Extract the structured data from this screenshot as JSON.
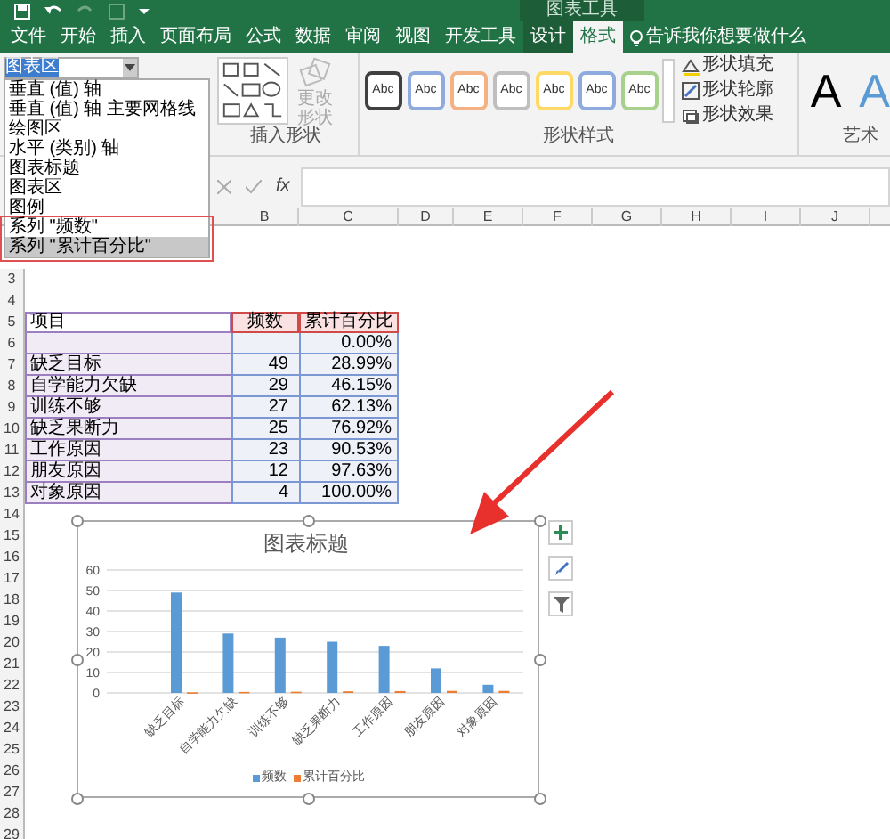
{
  "title_bar": {
    "context_label": "图表工具"
  },
  "ribbon_tabs": [
    {
      "label": "文件",
      "selected": false,
      "kind": "plain"
    },
    {
      "label": "开始",
      "selected": false,
      "kind": "plain"
    },
    {
      "label": "插入",
      "selected": false,
      "kind": "plain"
    },
    {
      "label": "页面布局",
      "selected": false,
      "kind": "plain"
    },
    {
      "label": "公式",
      "selected": false,
      "kind": "plain"
    },
    {
      "label": "数据",
      "selected": false,
      "kind": "plain"
    },
    {
      "label": "审阅",
      "selected": false,
      "kind": "plain"
    },
    {
      "label": "视图",
      "selected": false,
      "kind": "plain"
    },
    {
      "label": "开发工具",
      "selected": false,
      "kind": "plain"
    },
    {
      "label": "设计",
      "selected": false,
      "kind": "context"
    },
    {
      "label": "格式",
      "selected": true,
      "kind": "context"
    }
  ],
  "tell_me": "告诉我你想要做什么",
  "selection_box": {
    "value": "图表区"
  },
  "selection_dropdown": [
    {
      "label": "垂直 (值) 轴",
      "selected": false
    },
    {
      "label": "垂直 (值) 轴 主要网格线",
      "selected": false
    },
    {
      "label": "绘图区",
      "selected": false
    },
    {
      "label": "水平 (类别) 轴",
      "selected": false
    },
    {
      "label": "图表标题",
      "selected": false
    },
    {
      "label": "图表区",
      "selected": false
    },
    {
      "label": "图例",
      "selected": false
    },
    {
      "label": "系列 \"频数\"",
      "selected": false
    },
    {
      "label": "系列 \"累计百分比\"",
      "selected": true
    }
  ],
  "insert_shapes": {
    "change_shape": "更改形状",
    "label": "插入形状"
  },
  "shape_styles": {
    "swatches": [
      {
        "text": "Abc",
        "color": "#404040"
      },
      {
        "text": "Abc",
        "color": "#8faadc"
      },
      {
        "text": "Abc",
        "color": "#f4b183"
      },
      {
        "text": "Abc",
        "color": "#bfbfbf"
      },
      {
        "text": "Abc",
        "color": "#ffd966"
      },
      {
        "text": "Abc",
        "color": "#8faadc"
      },
      {
        "text": "Abc",
        "color": "#a9d18e"
      }
    ],
    "commands": [
      "形状填充",
      "形状轮廓",
      "形状效果"
    ],
    "label": "形状样式"
  },
  "wordart": {
    "samples": [
      {
        "text": "A",
        "color": "#000000"
      },
      {
        "text": "A",
        "color": "#5b9bd5"
      }
    ],
    "label": "艺术"
  },
  "formula_bar": {
    "function_label": "fx"
  },
  "columns": [
    "B",
    "C",
    "D",
    "E",
    "F",
    "G",
    "H",
    "I",
    "J"
  ],
  "row_numbers": [
    "3",
    "4",
    "5",
    "6",
    "7",
    "8",
    "9",
    "10",
    "11",
    "12",
    "13",
    "14",
    "15",
    "16",
    "17",
    "18",
    "19",
    "20",
    "21",
    "22",
    "23",
    "24",
    "25",
    "26",
    "27",
    "28",
    "29"
  ],
  "table": {
    "header": [
      "项目",
      "频数",
      "累计百分比"
    ],
    "rows": [
      {
        "percent": "0.00%"
      },
      {
        "item": "缺乏目标",
        "count": "49",
        "percent": "28.99%"
      },
      {
        "item": "自学能力欠缺",
        "count": "29",
        "percent": "46.15%"
      },
      {
        "item": "训练不够",
        "count": "27",
        "percent": "62.13%"
      },
      {
        "item": "缺乏果断力",
        "count": "25",
        "percent": "76.92%"
      },
      {
        "item": "工作原因",
        "count": "23",
        "percent": "90.53%"
      },
      {
        "item": "朋友原因",
        "count": "12",
        "percent": "97.63%"
      },
      {
        "item": "对象原因",
        "count": "4",
        "percent": "100.00%"
      }
    ]
  },
  "chart": {
    "chart_data": {
      "type": "bar",
      "title": "图表标题",
      "categories": [
        "缺乏目标",
        "自学能力欠缺",
        "训练不够",
        "缺乏果断力",
        "工作原因",
        "朋友原因",
        "对象原因"
      ],
      "series": [
        {
          "name": "频数",
          "color": "#5b9bd5",
          "values": [
            49,
            29,
            27,
            25,
            23,
            12,
            4
          ]
        },
        {
          "name": "累计百分比",
          "color": "#ed7d31",
          "values": [
            0.3,
            0.5,
            0.6,
            0.8,
            0.9,
            1,
            1
          ]
        }
      ],
      "ylim": [
        0,
        60
      ],
      "yticks": [
        {
          "value": 0,
          "label": "0"
        },
        {
          "value": 10,
          "label": "10"
        },
        {
          "value": 20,
          "label": "20"
        },
        {
          "value": 30,
          "label": "30"
        },
        {
          "value": 40,
          "label": "40"
        },
        {
          "value": 50,
          "label": "50"
        },
        {
          "value": 60,
          "label": "60"
        }
      ],
      "grid": true,
      "legend": true
    }
  }
}
